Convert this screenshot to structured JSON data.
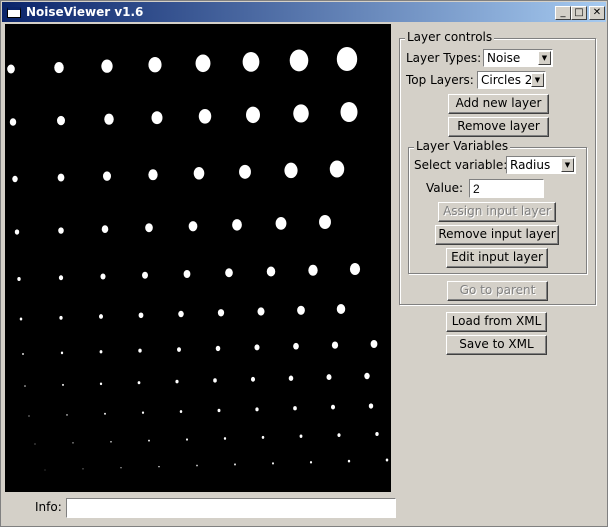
{
  "window": {
    "title": "NoiseViewer v1.6",
    "minimize_glyph": "_",
    "maximize_glyph": "□",
    "close_glyph": "✕"
  },
  "info": {
    "label": "Info:",
    "value": ""
  },
  "layer_controls": {
    "title": "Layer controls",
    "layer_types_label": "Layer Types:",
    "layer_types_value": "Noise",
    "top_layers_label": "Top Layers:",
    "top_layers_value": "Circles 2",
    "add_new_layer": "Add new layer",
    "remove_layer": "Remove layer",
    "go_to_parent": "Go to parent"
  },
  "layer_variables": {
    "title": "Layer Variables",
    "select_variable_label": "Select variable:",
    "select_variable_value": "Radius",
    "value_label": "Value:",
    "value": "2",
    "assign_input_layer": "Assign input layer",
    "remove_input_layer": "Remove input layer",
    "edit_input_layer": "Edit input layer"
  },
  "load_from_xml": "Load from XML",
  "save_to_xml": "Save to XML",
  "colors": {
    "canvas_bg": "#000000",
    "dot": "#ffffff",
    "titlebar_start": "#0a246a",
    "titlebar_end": "#a6caf0"
  },
  "icons": {
    "dropdown_arrow": "▼"
  }
}
